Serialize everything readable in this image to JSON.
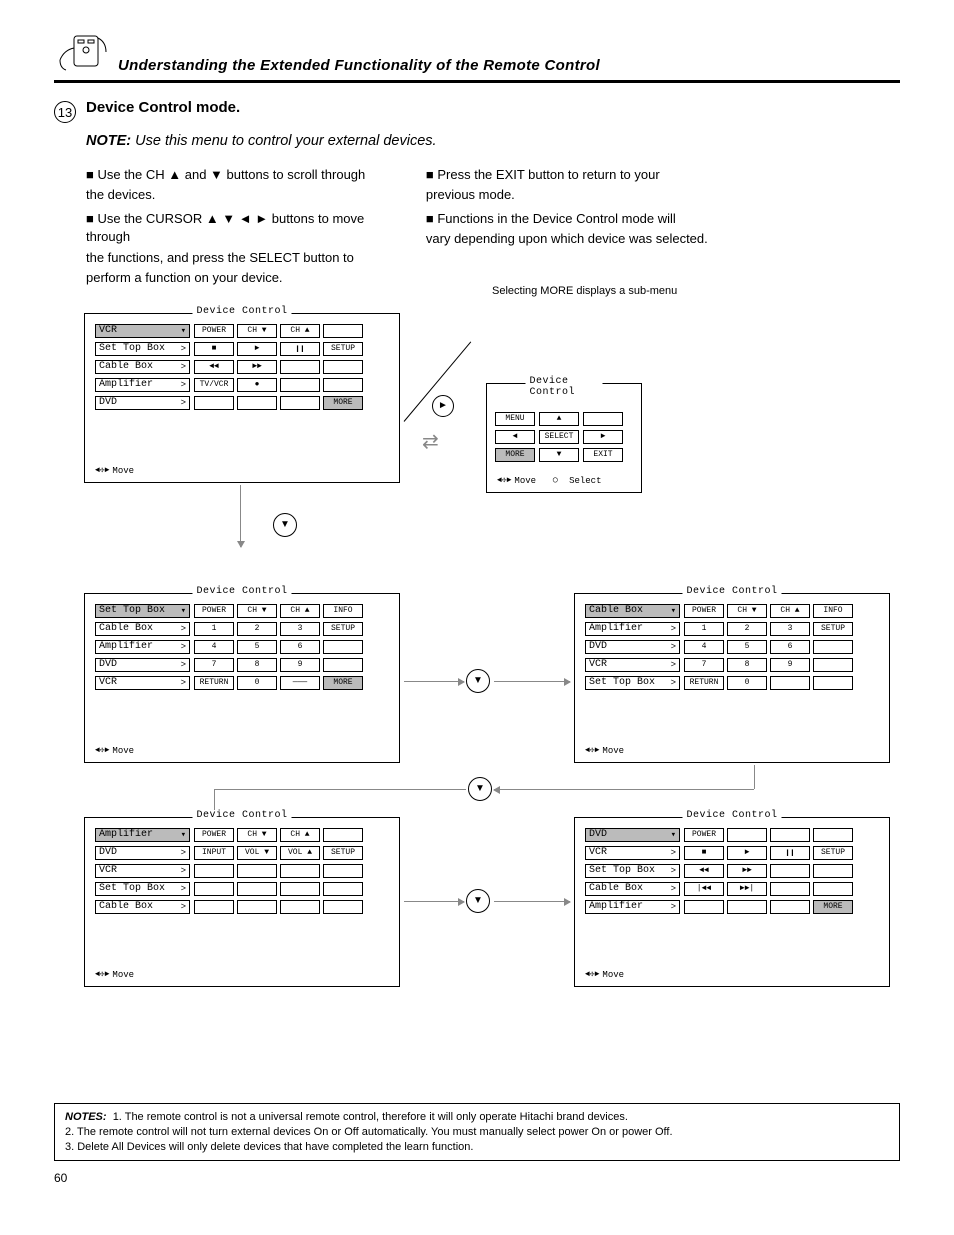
{
  "symbols": {
    "up": "▲",
    "down": "▼",
    "left": "◄",
    "right": "►",
    "play": "►",
    "stop": "■",
    "pause": "❙❙",
    "rec": "●",
    "rew": "◄◄",
    "ff": "►►",
    "prev": "|◄◄",
    "next": "►►|",
    "chev": ">"
  },
  "header": {
    "title": "Understanding the Extended Functionality of the Remote Control"
  },
  "step": {
    "num": "13",
    "headline": "Device Control mode.",
    "note": "Use this menu to control your external devices.",
    "colA": [
      "■ Use the CH  ▲  and  ▼  buttons to scroll through",
      "the devices.",
      "■ Use the CURSOR  ▲ ▼ ◄ ► buttons to move through",
      "the functions, and press the SELECT button to",
      "perform a function on your device."
    ],
    "colB": [
      "■ Press the EXIT button to return to your",
      "previous mode.",
      "■ Functions in the Device Control mode will",
      "vary depending upon which device was selected."
    ]
  },
  "anno": {
    "p1": "Selecting MORE displays a sub-menu"
  },
  "btns": {
    "power": "POWER",
    "chdn": "CH ▼",
    "chup": "CH ▲",
    "info": "INFO",
    "setup": "SETUP",
    "more": "MORE",
    "tvvcr": "TV/VCR",
    "return": "RETURN",
    "n1": "1",
    "n2": "2",
    "n3": "3",
    "n4": "4",
    "n5": "5",
    "n6": "6",
    "n7": "7",
    "n8": "8",
    "n9": "9",
    "n0": "0",
    "input": "INPUT",
    "voldn": "VOL ▼",
    "volup": "VOL ▲",
    "menu": "MENU",
    "select": "SELECT",
    "exit": "EXIT",
    "line": "———"
  },
  "devices": {
    "vcr": "VCR",
    "stb": "Set Top Box",
    "cable": "Cable Box",
    "amp": "Amplifier",
    "dvd": "DVD"
  },
  "foot": {
    "move": "Move",
    "select": "Select"
  },
  "panelTitle": "Device Control",
  "notes": {
    "label": "NOTES:",
    "n1": "1. The remote control is not a universal remote control, therefore it will only operate Hitachi brand devices.",
    "n2": "2. The remote control will not turn external devices On or Off automatically. You must manually select power On or power Off.",
    "n3": "3. Delete All Devices will only delete devices that have completed the learn function."
  },
  "pageNum": "60"
}
